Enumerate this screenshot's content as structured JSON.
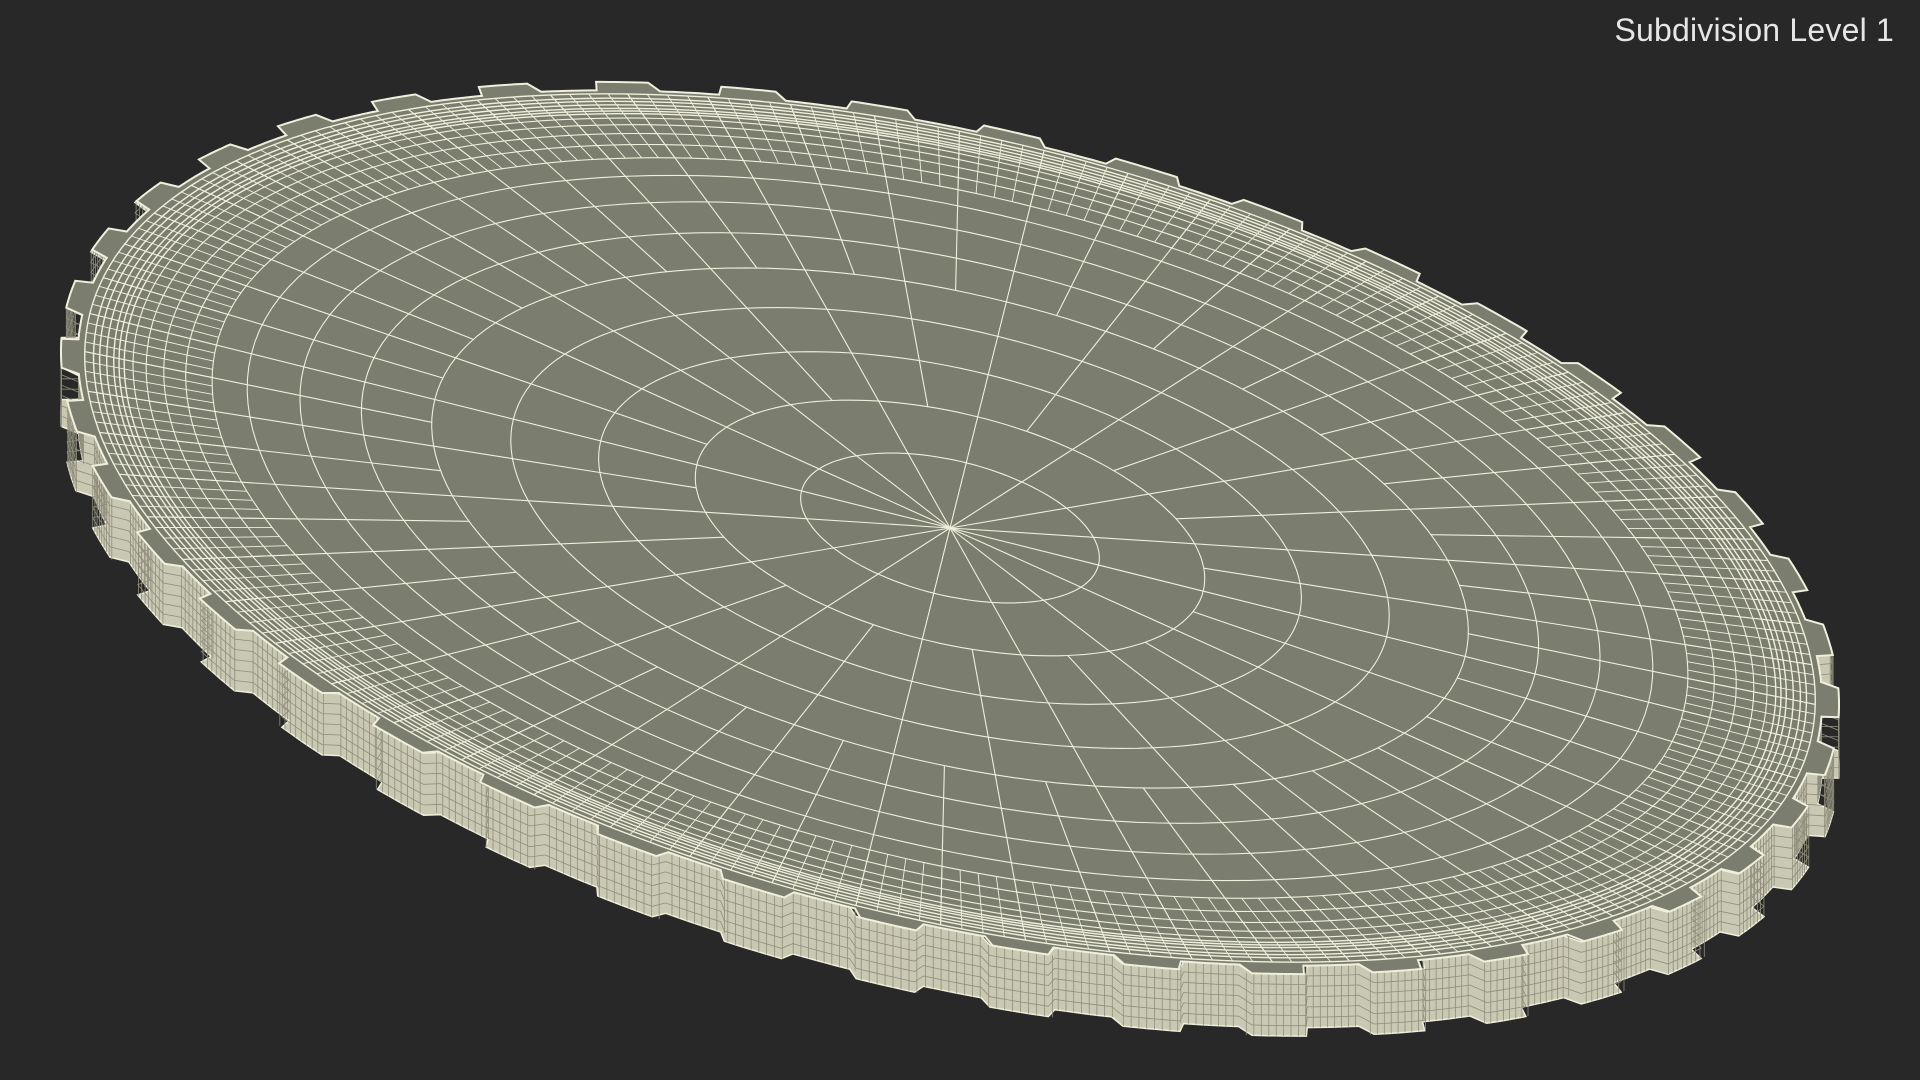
{
  "viewport": {
    "label": "Subdivision Level 1",
    "background_color": "#282828",
    "surface_color": "#7b7d6e",
    "side_color": "#c9c8b3",
    "wire_color": "#efefdc"
  },
  "model": {
    "object": "wireframe-bottle-cap",
    "ridge_count": 42
  }
}
